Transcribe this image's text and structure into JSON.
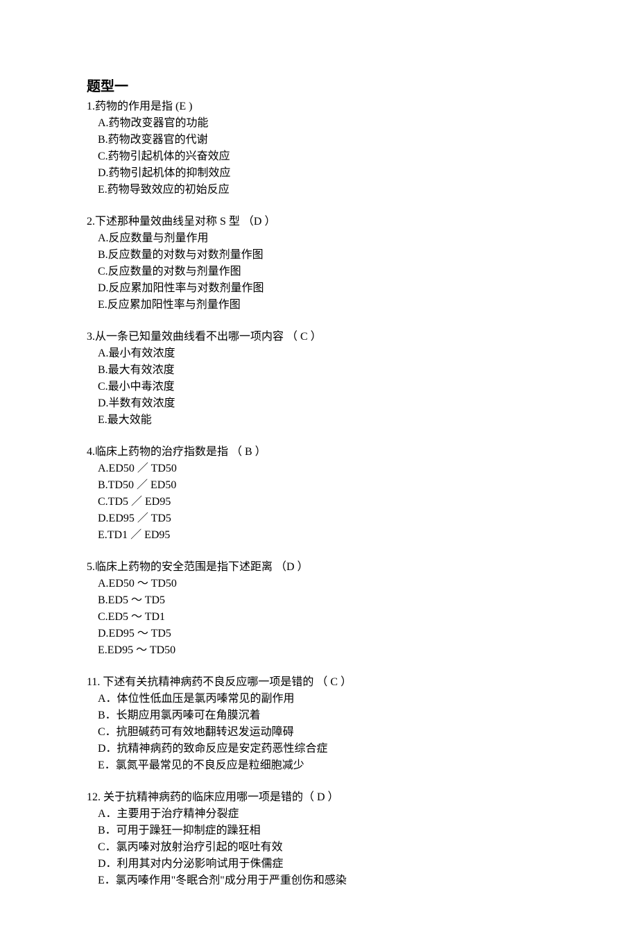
{
  "title": "题型一",
  "questions": [
    {
      "stem": "1.药物的作用是指   (E )",
      "options": [
        "A.药物改变器官的功能",
        "B.药物改变器官的代谢",
        "C.药物引起机体的兴奋效应",
        "D.药物引起机体的抑制效应",
        "E.药物导致效应的初始反应"
      ]
    },
    {
      "stem": "2.下述那种量效曲线呈对称 S 型   （D ）",
      "options": [
        "A.反应数量与剂量作用",
        "B.反应数量的对数与对数剂量作图",
        "C.反应数量的对数与剂量作图",
        "D.反应累加阳性率与对数剂量作图",
        "E.反应累加阳性率与剂量作图"
      ]
    },
    {
      "stem": "3.从一条已知量效曲线看不出哪一项内容   （ C  ）",
      "options": [
        "A.最小有效浓度",
        "B.最大有效浓度",
        "C.最小中毒浓度",
        "D.半数有效浓度",
        "E.最大效能"
      ]
    },
    {
      "stem": "4.临床上药物的治疗指数是指   （ B  ）",
      "options": [
        "A.ED50 ／ TD50",
        "B.TD50 ／ ED50",
        "C.TD5  ／ ED95",
        "D.ED95 ／ TD5",
        "E.TD1  ／ ED95"
      ]
    },
    {
      "stem": "5.临床上药物的安全范围是指下述距离   （D ）",
      "options": [
        "A.ED50 ～ TD50",
        "B.ED5  ～ TD5",
        "C.ED5  ～ TD1",
        "D.ED95 ～ TD5",
        "E.ED95 ～ TD50"
      ]
    },
    {
      "stem": "11. 下述有关抗精神病药不良反应哪一项是错的   （ C ）",
      "options": [
        "A．体位性低血压是氯丙嗪常见的副作用",
        "B．长期应用氯丙嗪可在角膜沉着",
        "C．抗胆碱药可有效地翻转迟发运动障碍",
        "D．抗精神病药的致命反应是安定药恶性综合症",
        "E．氯氮平最常见的不良反应是粒细胞减少"
      ]
    },
    {
      "stem": "12. 关于抗精神病药的临床应用哪一项是错的（ D ）",
      "options": [
        "A．主要用于治疗精神分裂症",
        "B．可用于躁狂一抑制症的躁狂相",
        "C．氯丙嗪对放射治疗引起的呕吐有效",
        "D．利用其对内分泌影响试用于侏儒症",
        "E．氯丙嗪作用\"冬眠合剂\"成分用于严重创伤和感染"
      ]
    }
  ]
}
